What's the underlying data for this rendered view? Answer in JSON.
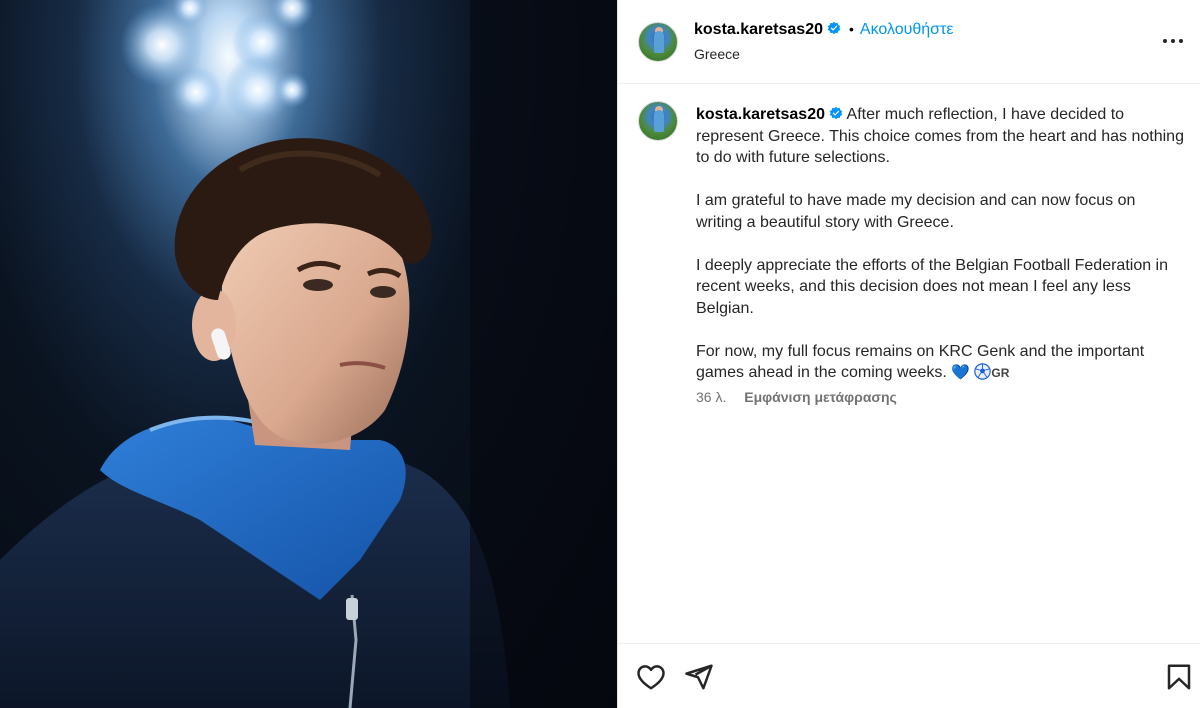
{
  "post": {
    "username": "kosta.karetsas20",
    "follow_label": "Ακολουθήστε",
    "separator": "•",
    "location": "Greece"
  },
  "caption": {
    "username": "kosta.karetsas20",
    "paragraph_1": "After much reflection, I have decided to represent Greece. This choice comes from the heart and has nothing to do with future selections.",
    "paragraph_2": "I am grateful to have made my decision and can now focus on writing a beautiful story with Greece.",
    "paragraph_3": "I deeply appreciate the efforts of the Belgian Football Federation in recent weeks, and this decision does not mean I feel any less Belgian.",
    "paragraph_4": "For now, my full focus remains on KRC Genk and the important games ahead in the coming weeks.",
    "emoji_heart": "💙",
    "emoji_flag": "GR",
    "time_ago": "36 λ.",
    "translation_link": "Εμφάνιση μετάφρασης"
  },
  "icons": {
    "verified": "verified-badge-icon",
    "more": "more-options-icon",
    "like": "heart-icon",
    "share": "share-icon",
    "save": "bookmark-icon"
  },
  "colors": {
    "follow": "#0095f6",
    "verified": "#0095f6",
    "secondary_text": "#737373"
  }
}
